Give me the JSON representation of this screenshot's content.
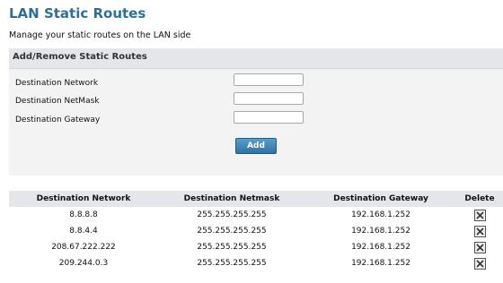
{
  "page": {
    "title": "LAN Static Routes",
    "subtitle": "Manage your static routes on the LAN side"
  },
  "form": {
    "header": "Add/Remove Static Routes",
    "fields": [
      {
        "label": "Destination Network",
        "value": ""
      },
      {
        "label": "Destination NetMask",
        "value": ""
      },
      {
        "label": "Destination Gateway",
        "value": ""
      }
    ],
    "add_label": "Add"
  },
  "table": {
    "headers": [
      "Destination Network",
      "Destination Netmask",
      "Destination Gateway",
      "Delete"
    ],
    "rows": [
      {
        "network": "8.8.8.8",
        "netmask": "255.255.255.255",
        "gateway": "192.168.1.252",
        "delete_icon": "close-icon"
      },
      {
        "network": "8.8.4.4",
        "netmask": "255.255.255.255",
        "gateway": "192.168.1.252",
        "delete_icon": "close-icon"
      },
      {
        "network": "208.67.222.222",
        "netmask": "255.255.255.255",
        "gateway": "192.168.1.252",
        "delete_icon": "close-icon"
      },
      {
        "network": "209.244.0.3",
        "netmask": "255.255.255.255",
        "gateway": "192.168.1.252",
        "delete_icon": "close-icon"
      }
    ]
  },
  "colors": {
    "title": "#2c6f9a",
    "button": "#2f73a6",
    "panel_bg": "#f3f3f3",
    "header_bg": "#e4e6e9"
  }
}
